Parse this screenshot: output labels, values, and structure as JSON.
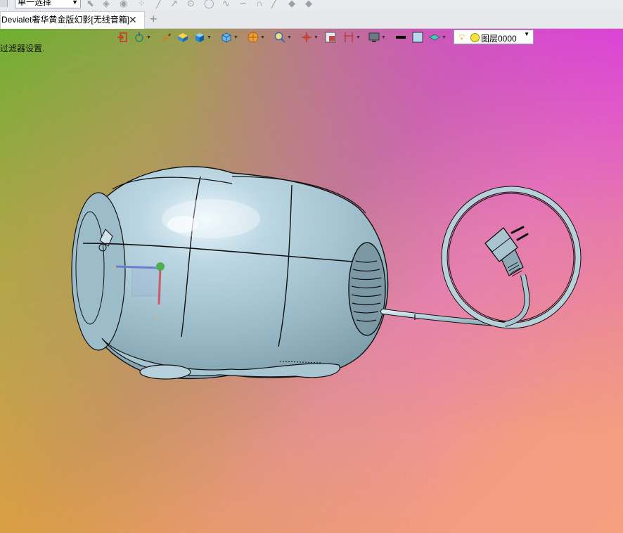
{
  "toolbar_top": {
    "selection_mode": "单一选择"
  },
  "tabs": {
    "document_title": "Devialet奢华黄金版幻影[无线音箱]",
    "close_symbol": "✕",
    "add_symbol": "+"
  },
  "viewport": {
    "status_text": "过滤器设置.",
    "layer_name": "图层0000",
    "background_colors": [
      "#6db030",
      "#d9248a",
      "#e6ab2a",
      "#f49a88"
    ]
  },
  "view_toolbar": {
    "icons": [
      "exit-icon",
      "orbit-icon",
      "brush-icon",
      "shaded-box-icon",
      "cube-view-icon",
      "wireframe-cube-icon",
      "render-mode-icon",
      "zoom-icon",
      "axis-icon",
      "section-icon",
      "frame-icon",
      "monitor-icon",
      "line-color-icon",
      "fill-color-icon",
      "layer-stack-icon",
      "light-bulb-icon"
    ]
  },
  "model": {
    "description_colors": {
      "body": "#a9c7d4",
      "highlight": "#dff1f8",
      "edge": "#111111"
    }
  }
}
